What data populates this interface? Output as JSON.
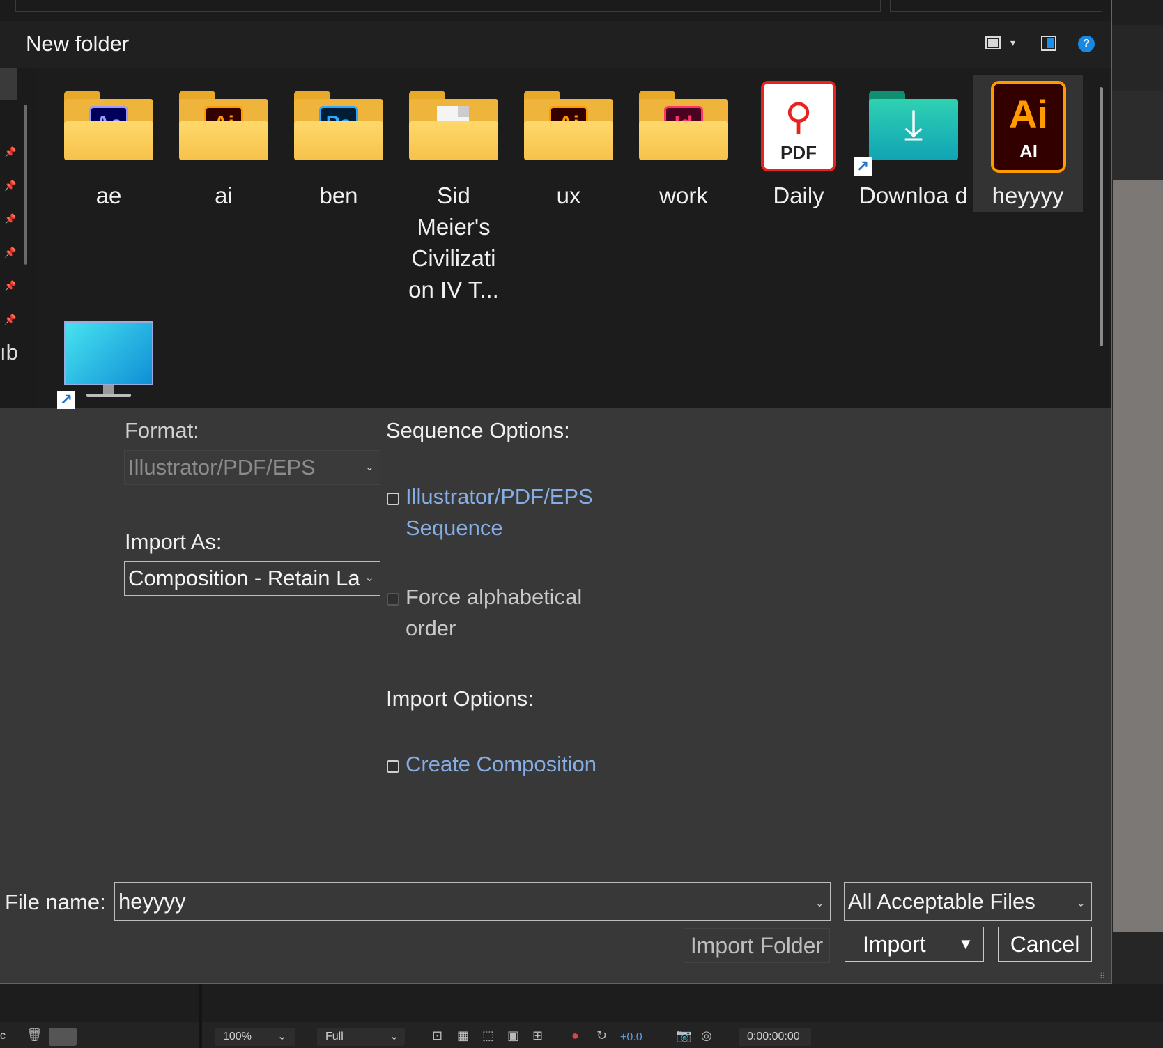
{
  "toolbar": {
    "title": "New folder",
    "view_icon": "view-mode-icon",
    "pane_icon": "preview-pane-icon",
    "help_label": "?"
  },
  "nav": {
    "partial_label": "ıb"
  },
  "files": [
    {
      "name": "ae",
      "icon": "ae-folder-icon",
      "badge": "Ae"
    },
    {
      "name": "ai",
      "icon": "ai-folder-icon",
      "badge": "Ai"
    },
    {
      "name": "ben",
      "icon": "ps-folder-icon",
      "badge": "Ps"
    },
    {
      "name": "Sid Meier's Civilizati on IV T...",
      "icon": "document-folder-icon",
      "badge": ""
    },
    {
      "name": "ux",
      "icon": "ai-folder-icon",
      "badge": "Ai"
    },
    {
      "name": "work",
      "icon": "id-folder-icon",
      "badge": "Id"
    },
    {
      "name": "Daily",
      "icon": "pdf-file-icon",
      "badge": "PDF"
    },
    {
      "name": "Downloa d",
      "icon": "downloads-shortcut-icon",
      "badge": ""
    },
    {
      "name": "heyyyy",
      "icon": "ai-file-icon",
      "badge": "Ai",
      "sub": "AI"
    },
    {
      "name": "",
      "icon": "desktop-shortcut-icon",
      "badge": ""
    }
  ],
  "options": {
    "format_label": "Format:",
    "format_value": "Illustrator/PDF/EPS",
    "import_as_label": "Import As:",
    "import_as_value": "Composition - Retain La",
    "sequence_label": "Sequence Options:",
    "sequence_checkbox": "Illustrator/PDF/EPS Sequence",
    "force_alpha": "Force alphabetical order",
    "import_options_label": "Import Options:",
    "create_comp": "Create Composition"
  },
  "footer": {
    "file_name_label": "File name:",
    "file_name_value": "heyyyy",
    "filter_value": "All Acceptable Files",
    "import_folder": "Import Folder",
    "import": "Import",
    "cancel": "Cancel"
  },
  "appbar": {
    "zoom": "100%",
    "resolution": "Full",
    "exposure": "+0.0",
    "timecode": "0:00:00:00",
    "left_char": "c"
  },
  "colors": {
    "accent_link": "#86aee6",
    "dialog_bg": "#383838",
    "browser_bg": "#1c1c1c",
    "border_accent": "#3e6f87"
  }
}
